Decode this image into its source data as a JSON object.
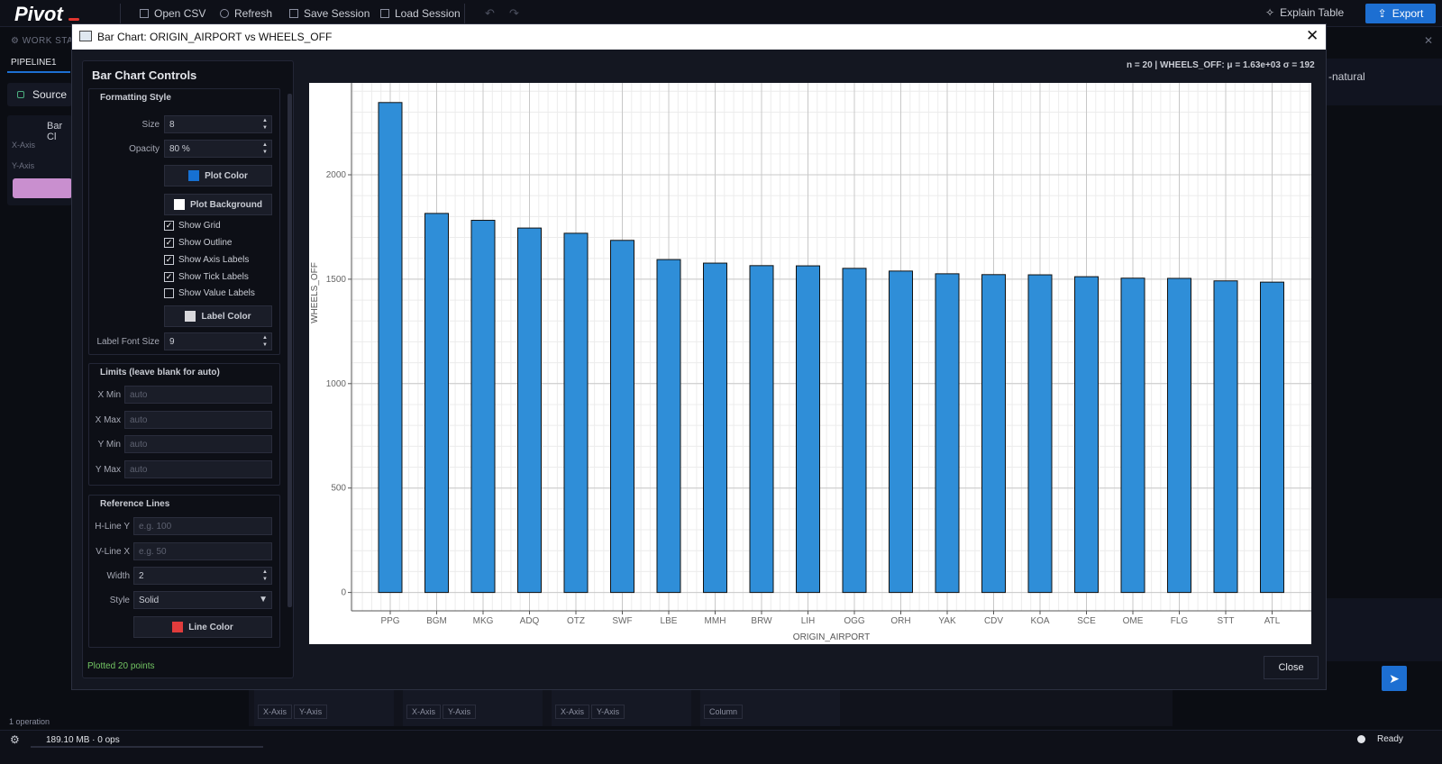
{
  "app": {
    "logo": "Pivot",
    "toolbar": {
      "open_csv": "Open CSV",
      "refresh": "Refresh",
      "save_session": "Save Session",
      "load_session": "Load Session",
      "explain_table": "Explain Table",
      "export": "Export"
    },
    "workspace_label": "WORK STA",
    "pipeline_tab": "PIPELINE1",
    "source_label": "Source",
    "node_label": "Bar Cl",
    "x_axis": "X-Axis",
    "y_axis": "Y-Axis",
    "natural_label": "-natural",
    "chips": [
      "X-Axis",
      "Y-Axis",
      "X-Axis",
      "Y-Axis",
      "X-Axis",
      "Y-Axis",
      "Column"
    ],
    "operations": "1 operation",
    "memory": "189.10 MB · 0 ops",
    "status": "Ready",
    "accent_color": "#1d6fd2"
  },
  "modal": {
    "title": "Bar Chart: ORIGIN_AIRPORT vs WHEELS_OFF",
    "stats": "n = 20  |  WHEELS_OFF: μ = 1.63e+03  σ = 192",
    "close_label": "Close",
    "controls": {
      "title": "Bar Chart Controls",
      "formatting": {
        "title": "Formatting Style",
        "size_label": "Size",
        "size_value": "8",
        "opacity_label": "Opacity",
        "opacity_value": "80 %",
        "plot_color_label": "Plot Color",
        "plot_color": "#1670d2",
        "plot_background_label": "Plot Background",
        "plot_background": "#ffffff",
        "checkboxes": [
          {
            "label": "Show Grid",
            "checked": true
          },
          {
            "label": "Show Outline",
            "checked": true
          },
          {
            "label": "Show Axis Labels",
            "checked": true
          },
          {
            "label": "Show Tick Labels",
            "checked": true
          },
          {
            "label": "Show Value Labels",
            "checked": false
          }
        ],
        "label_color_label": "Label Color",
        "label_color": "#d8d8dc",
        "label_font_size_label": "Label Font Size",
        "label_font_size_value": "9"
      },
      "limits": {
        "title": "Limits (leave blank for auto)",
        "xmin_label": "X Min",
        "xmax_label": "X Max",
        "ymin_label": "Y Min",
        "ymax_label": "Y Max",
        "placeholder": "auto"
      },
      "reference": {
        "title": "Reference Lines",
        "hline_label": "H-Line Y",
        "hline_placeholder": "e.g. 100",
        "vline_label": "V-Line X",
        "vline_placeholder": "e.g. 50",
        "width_label": "Width",
        "width_value": "2",
        "style_label": "Style",
        "style_value": "Solid",
        "line_color_label": "Line Color",
        "line_color": "#e03c3c"
      },
      "plotted_text": "Plotted 20 points"
    }
  },
  "chart_data": {
    "type": "bar",
    "xlabel": "ORIGIN_AIRPORT",
    "ylabel": "WHEELS_OFF",
    "categories": [
      "PPG",
      "BGM",
      "MKG",
      "ADQ",
      "OTZ",
      "SWF",
      "LBE",
      "MMH",
      "BRW",
      "LIH",
      "OGG",
      "ORH",
      "YAK",
      "CDV",
      "KOA",
      "SCE",
      "OME",
      "FLG",
      "STT",
      "ATL"
    ],
    "values": [
      2346,
      1815,
      1782,
      1745,
      1720,
      1686,
      1594,
      1577,
      1565,
      1564,
      1552,
      1539,
      1526,
      1522,
      1521,
      1512,
      1505,
      1504,
      1492,
      1486
    ],
    "yticks": [
      0,
      500,
      1000,
      1500,
      2000
    ],
    "ylim": [
      -88,
      2440
    ],
    "bar_color": "#2f8ed8",
    "grid": true
  }
}
